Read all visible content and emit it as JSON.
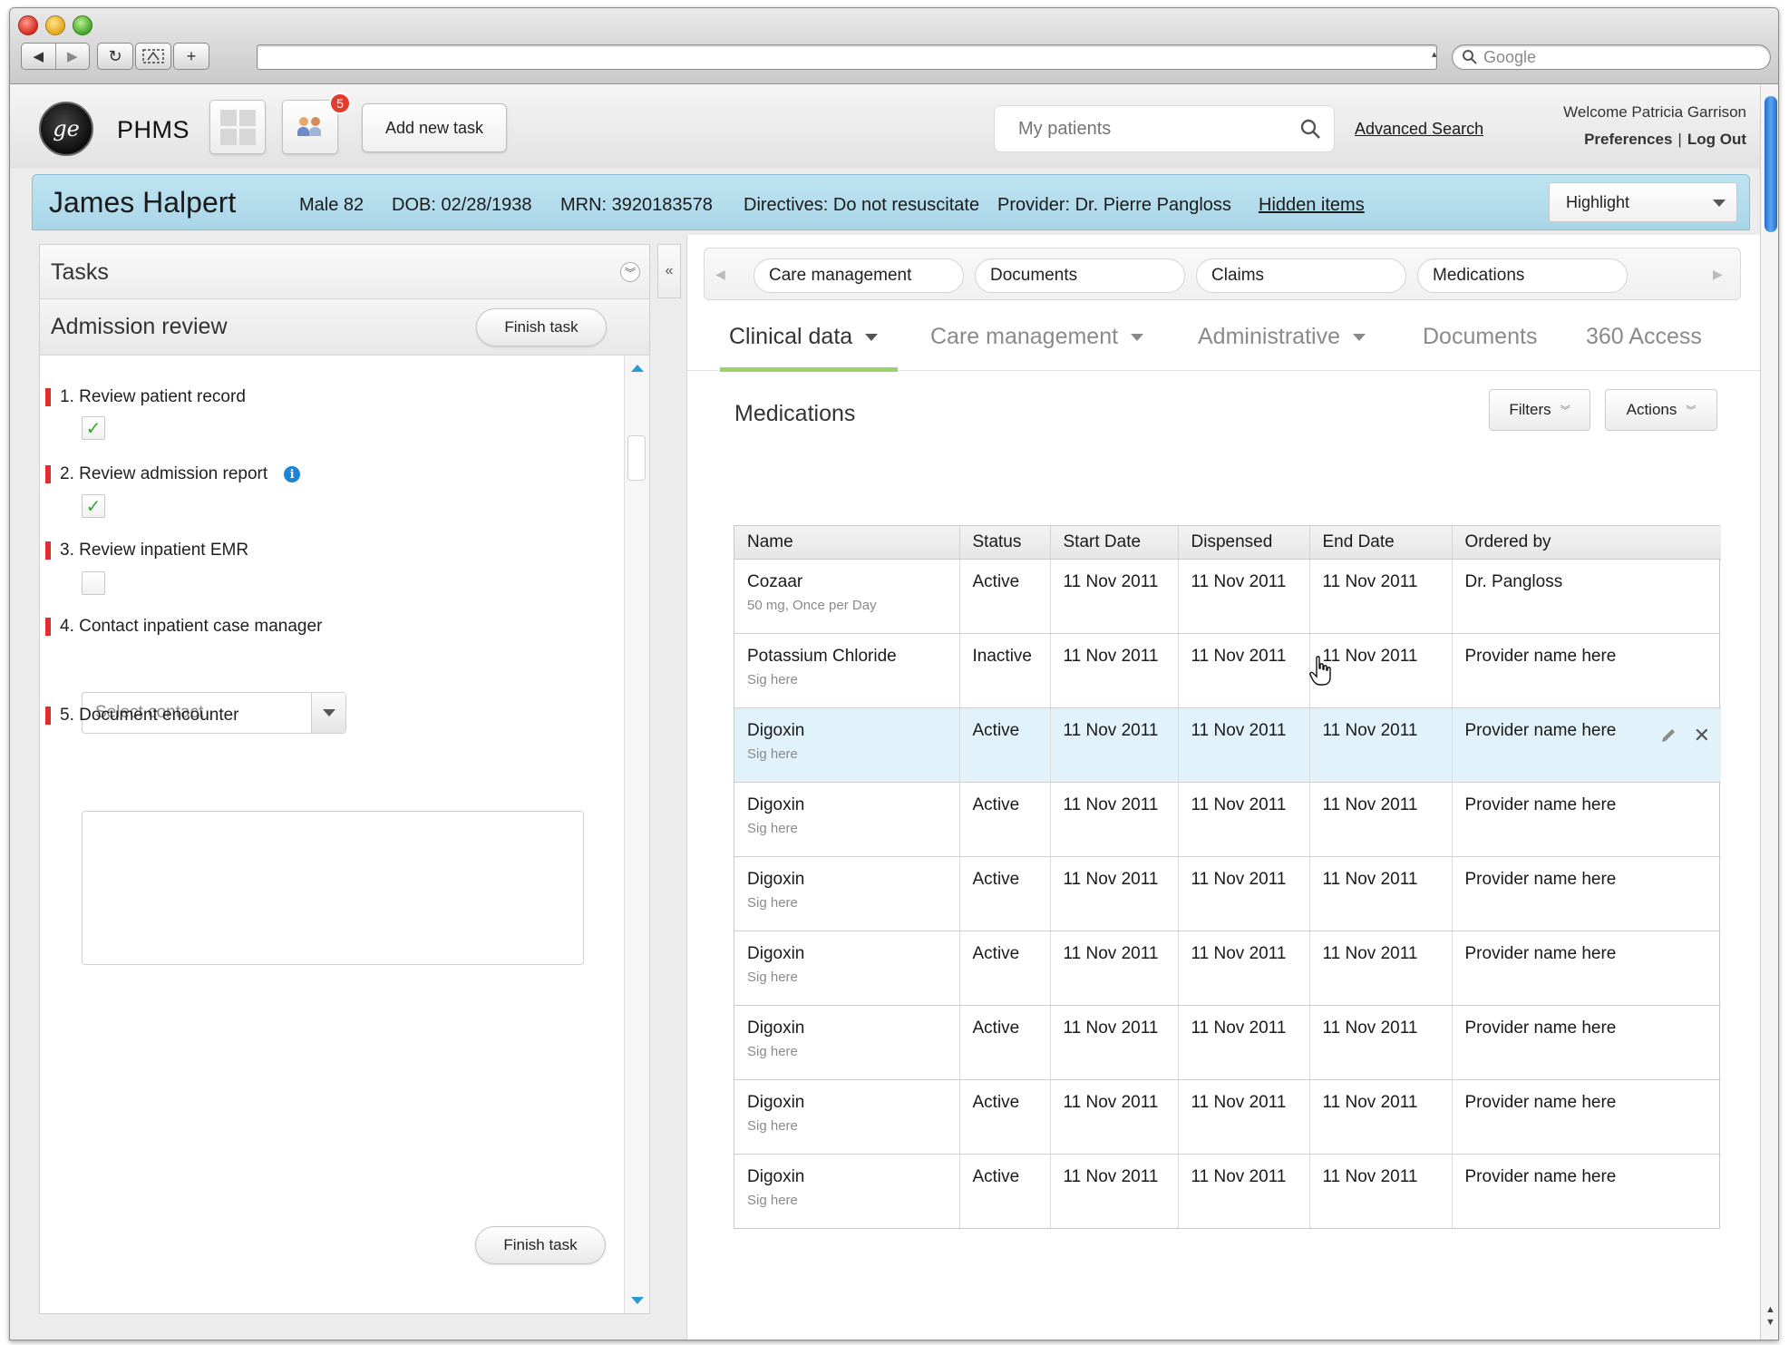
{
  "browser": {
    "search_placeholder": "Google"
  },
  "header": {
    "app_name": "PHMS",
    "notification_count": "5",
    "add_task_label": "Add new task",
    "search_placeholder": "My patients",
    "advanced_search": "Advanced Search",
    "welcome": "Welcome Patricia Garrison",
    "preferences": "Preferences",
    "separator": "|",
    "logout": "Log Out"
  },
  "patient": {
    "name": "James Halpert",
    "sex_age": "Male 82",
    "dob": "DOB: 02/28/1938",
    "mrn": "MRN: 3920183578",
    "directives": "Directives: Do not resuscitate",
    "provider": "Provider: Dr. Pierre Pangloss",
    "hidden_items": "Hidden items",
    "highlight_label": "Highlight"
  },
  "tasks": {
    "title": "Tasks",
    "review_title": "Admission review",
    "finish_label": "Finish task",
    "items": [
      {
        "label": "1. Review patient record",
        "checked": true
      },
      {
        "label": "2. Review admission report",
        "checked": true
      },
      {
        "label": "3. Review inpatient EMR",
        "checked": false
      },
      {
        "label": "4. Contact inpatient case manager"
      },
      {
        "label": "5. Document encounter"
      }
    ],
    "contact_placeholder": "Select contact",
    "check_mark": "✓"
  },
  "pills": [
    "Care management",
    "Documents",
    "Claims",
    "Medications"
  ],
  "tabs": [
    {
      "label": "Clinical data",
      "active": true
    },
    {
      "label": "Care management"
    },
    {
      "label": "Administrative"
    },
    {
      "label": "Documents"
    },
    {
      "label": "360 Access"
    }
  ],
  "medications": {
    "title": "Medications",
    "filters_label": "Filters",
    "actions_label": "Actions",
    "columns": [
      "Name",
      "Status",
      "Start Date",
      "Dispensed",
      "End Date",
      "Ordered by"
    ],
    "rows": [
      {
        "name": "Cozaar",
        "sig": "50 mg, Once per Day",
        "status": "Active",
        "start": "11 Nov 2011",
        "dispensed": "11 Nov 2011",
        "end": "11 Nov 2011",
        "ordered_by": "Dr. Pangloss"
      },
      {
        "name": "Potassium Chloride",
        "sig": "Sig here",
        "status": "Inactive",
        "start": "11 Nov 2011",
        "dispensed": "11 Nov 2011",
        "end": "11 Nov 2011",
        "ordered_by": "Provider name here"
      },
      {
        "name": "Digoxin",
        "sig": "Sig here",
        "status": "Active",
        "start": "11 Nov 2011",
        "dispensed": "11 Nov 2011",
        "end": "11 Nov 2011",
        "ordered_by": "Provider name here",
        "selected": true
      },
      {
        "name": "Digoxin",
        "sig": "Sig here",
        "status": "Active",
        "start": "11 Nov 2011",
        "dispensed": "11 Nov 2011",
        "end": "11 Nov 2011",
        "ordered_by": "Provider name here"
      },
      {
        "name": "Digoxin",
        "sig": "Sig here",
        "status": "Active",
        "start": "11 Nov 2011",
        "dispensed": "11 Nov 2011",
        "end": "11 Nov 2011",
        "ordered_by": "Provider name here"
      },
      {
        "name": "Digoxin",
        "sig": "Sig here",
        "status": "Active",
        "start": "11 Nov 2011",
        "dispensed": "11 Nov 2011",
        "end": "11 Nov 2011",
        "ordered_by": "Provider name here"
      },
      {
        "name": "Digoxin",
        "sig": "Sig here",
        "status": "Active",
        "start": "11 Nov 2011",
        "dispensed": "11 Nov 2011",
        "end": "11 Nov 2011",
        "ordered_by": "Provider name here"
      },
      {
        "name": "Digoxin",
        "sig": "Sig here",
        "status": "Active",
        "start": "11 Nov 2011",
        "dispensed": "11 Nov 2011",
        "end": "11 Nov 2011",
        "ordered_by": "Provider name here"
      },
      {
        "name": "Digoxin",
        "sig": "Sig here",
        "status": "Active",
        "start": "11 Nov 2011",
        "dispensed": "11 Nov 2011",
        "end": "11 Nov 2011",
        "ordered_by": "Provider name here"
      }
    ]
  },
  "colors": {
    "banner": "#a9d6e8",
    "task_marker": "#e12d2d",
    "tab_underline": "#9dd16f",
    "selected_row": "#e1f2fa",
    "badge": "#e53b2c"
  },
  "icons": [
    "close-window-icon",
    "minimize-window-icon",
    "zoom-window-icon",
    "back-arrow-icon",
    "forward-arrow-icon",
    "reload-icon",
    "screenshot-icon",
    "new-tab-icon",
    "search-icon",
    "ge-logo-icon",
    "grid-icon",
    "people-icon",
    "info-icon",
    "checkmark-icon",
    "pencil-icon",
    "close-icon",
    "hand-cursor-icon"
  ]
}
